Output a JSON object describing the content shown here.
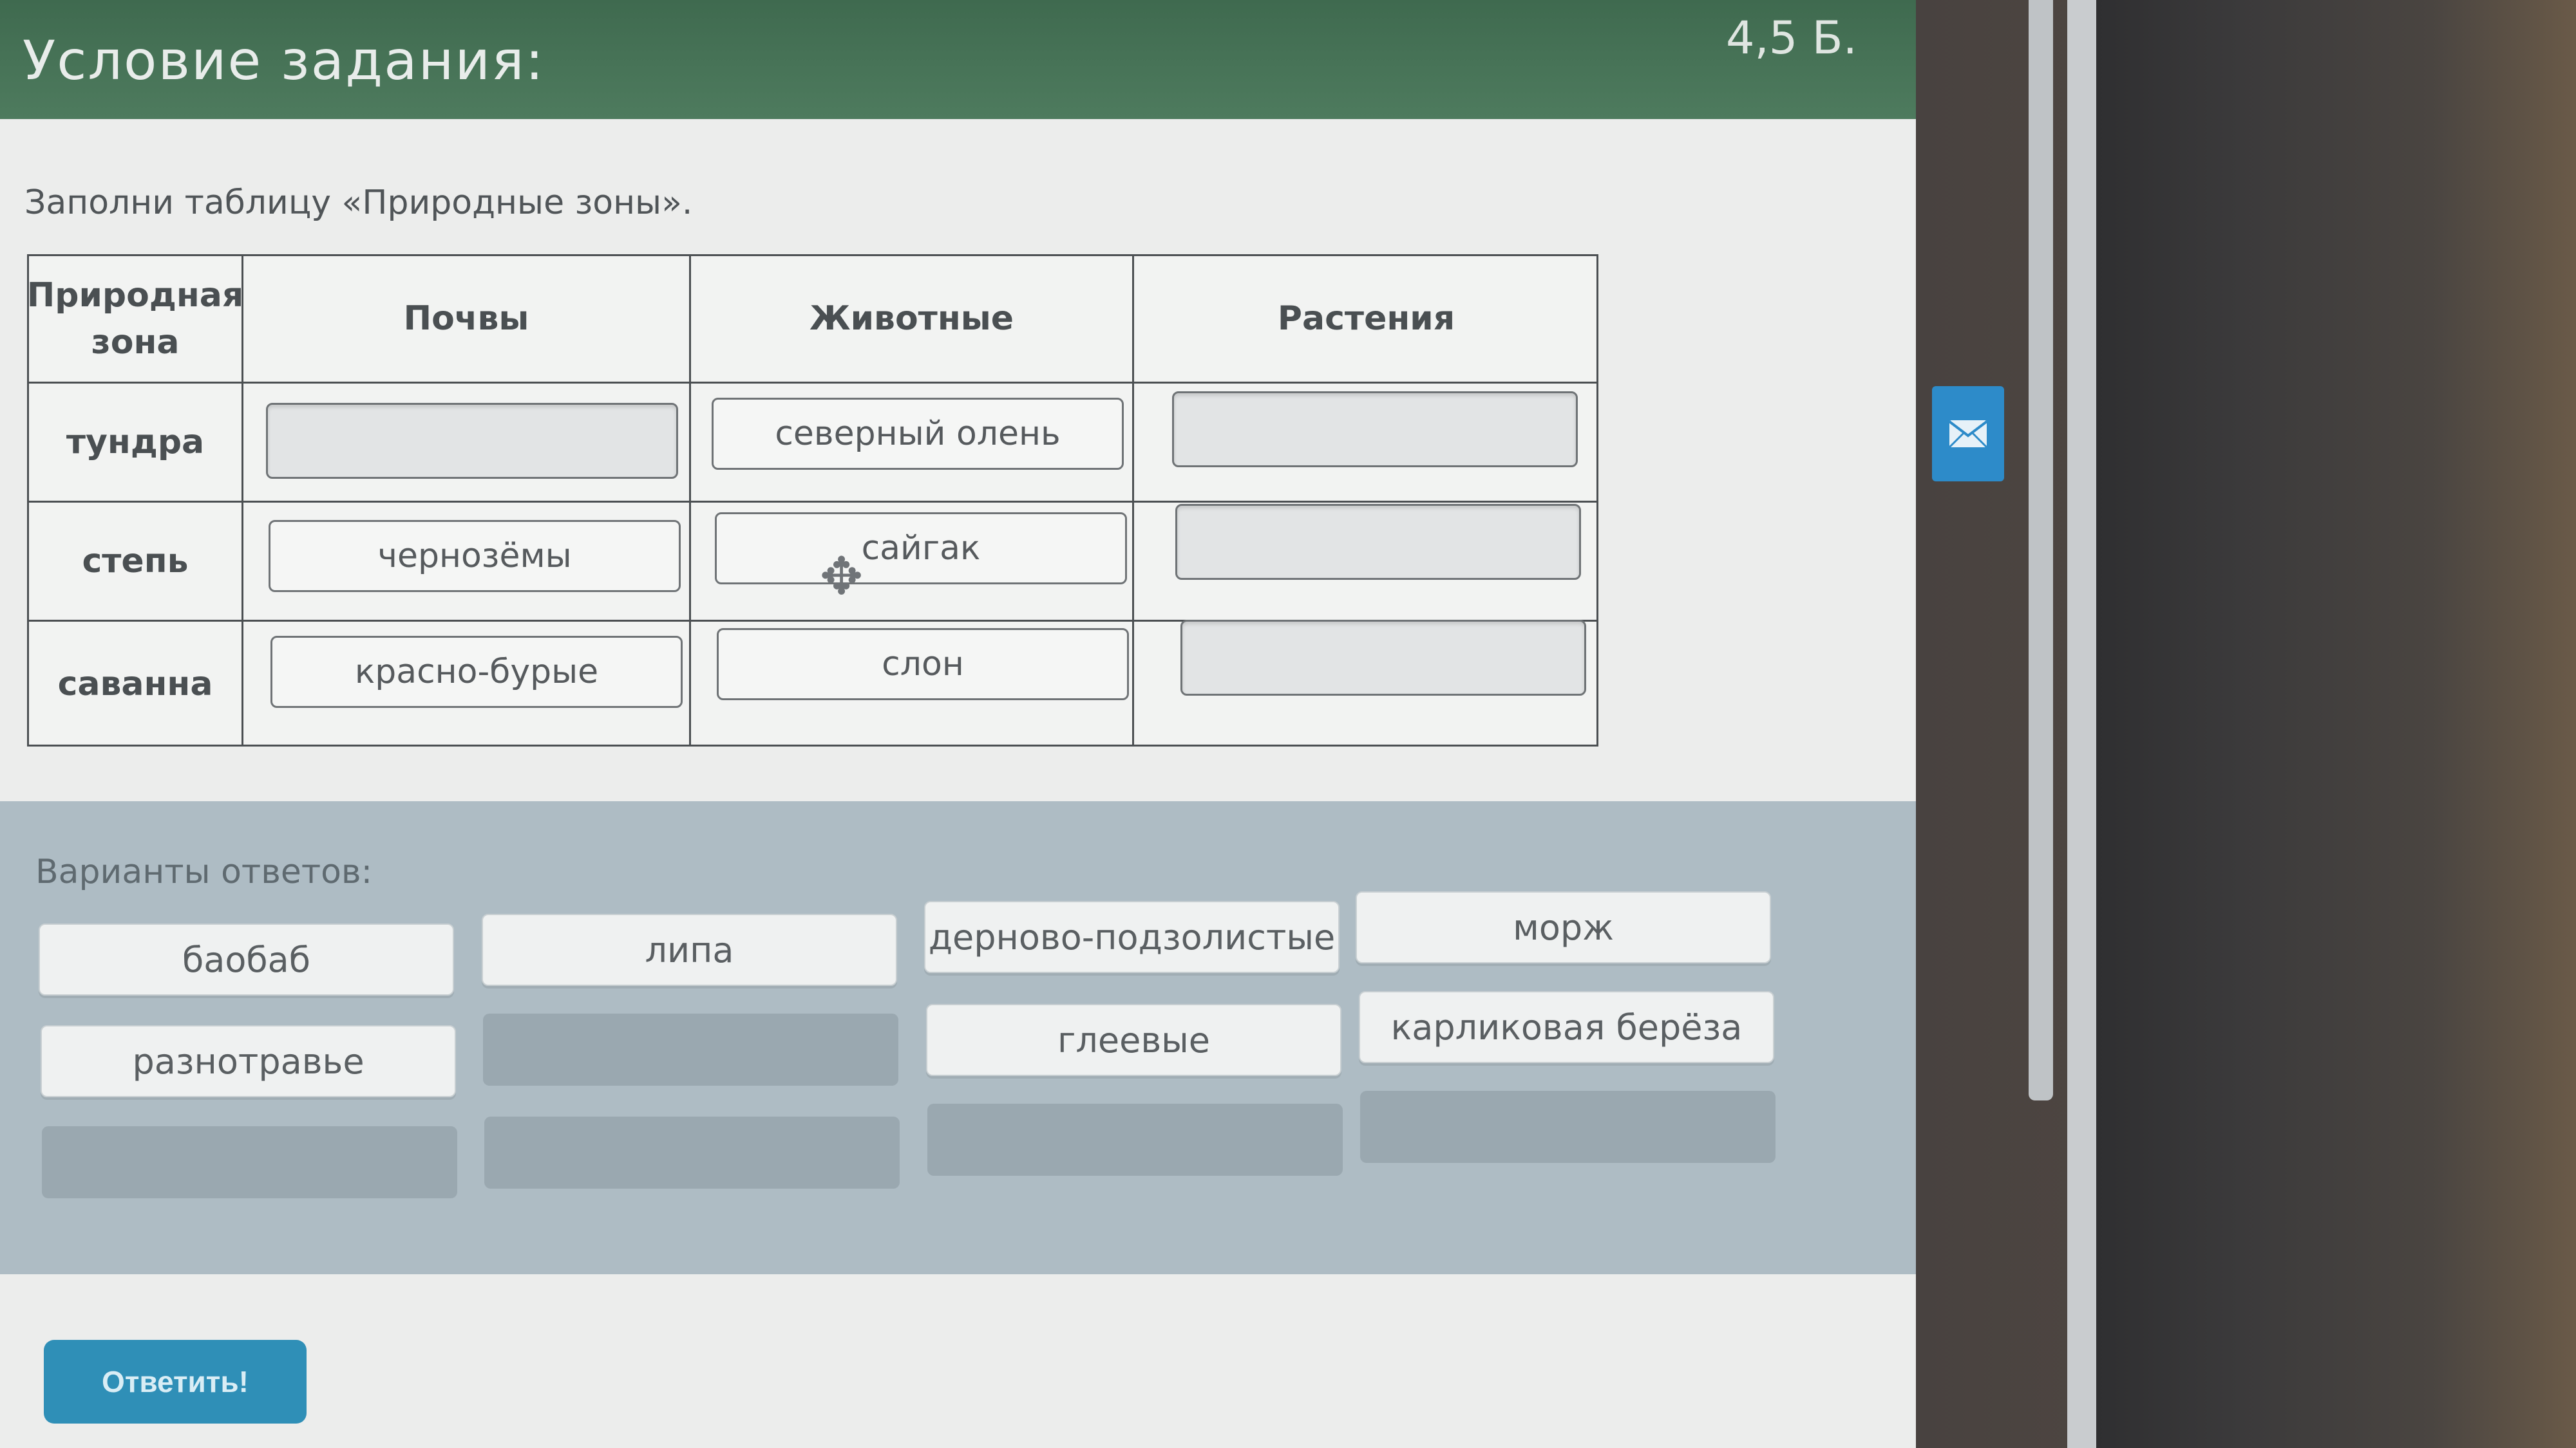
{
  "header": {
    "title": "Условие задания:",
    "score": "4,5 Б."
  },
  "instruction": "Заполни таблицу «Природные зоны».",
  "table": {
    "headers": [
      "Природная зона",
      "Почвы",
      "Животные",
      "Растения"
    ],
    "rows": [
      {
        "zone": "тундра",
        "soil": "",
        "animal": "северный олень",
        "plant": ""
      },
      {
        "zone": "степь",
        "soil": "чернозёмы",
        "animal": "сайгак",
        "plant": ""
      },
      {
        "zone": "саванна",
        "soil": "красно-бурые",
        "animal": "слон",
        "plant": ""
      }
    ]
  },
  "answers": {
    "label": "Варианты ответов:",
    "options": [
      "баобаб",
      "липа",
      "дерново-подзолистые",
      "морж",
      "разнотравье",
      "глеевые",
      "карликовая берёза"
    ]
  },
  "submit_label": "Ответить!",
  "icons": {
    "mail": "envelope-icon",
    "cursor": "move-cursor-icon"
  },
  "colors": {
    "header_bg": "#4e7b5e",
    "answers_bg": "#aebcc4",
    "submit_bg": "#2f8fb7",
    "mail_bg": "#2d8bc9"
  }
}
